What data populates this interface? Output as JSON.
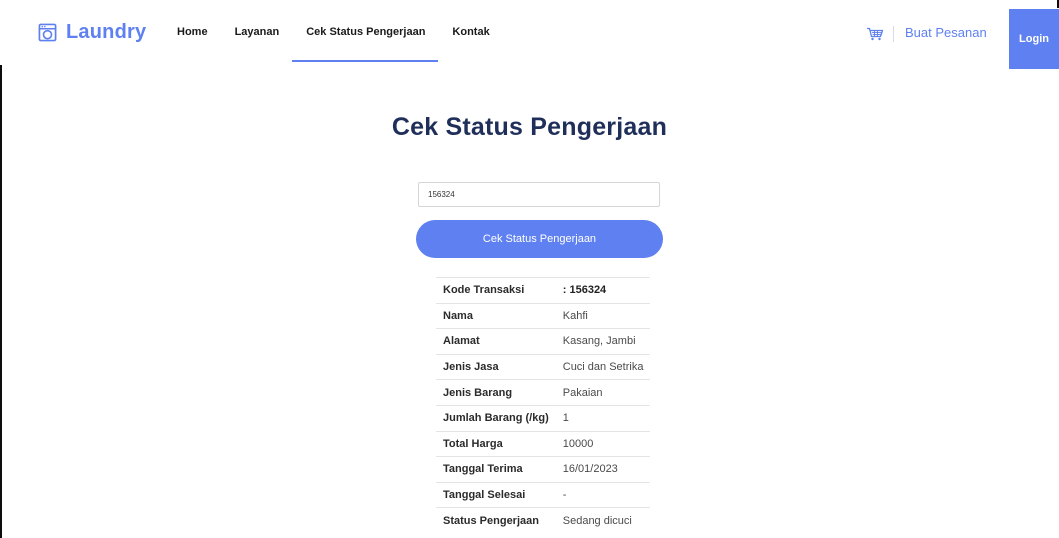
{
  "brand": {
    "name": "Laundry",
    "icon": "washing-machine-icon",
    "color": "#5f80f0"
  },
  "nav": {
    "items": [
      {
        "label": "Home"
      },
      {
        "label": "Layanan"
      },
      {
        "label": "Cek Status Pengerjaan",
        "active": true
      },
      {
        "label": "Kontak"
      }
    ],
    "cart_icon": "cart-icon",
    "order_label": "Buat Pesanan",
    "login_label": "Login"
  },
  "main": {
    "title": "Cek Status Pengerjaan",
    "search": {
      "value": "156324",
      "placeholder": ""
    },
    "submit_label": "Cek Status Pengerjaan",
    "details": [
      {
        "label": "Kode Transaksi",
        "value": ": 156324"
      },
      {
        "label": "Nama",
        "value": "Kahfi"
      },
      {
        "label": "Alamat",
        "value": "Kasang, Jambi"
      },
      {
        "label": "Jenis Jasa",
        "value": "Cuci dan Setrika"
      },
      {
        "label": "Jenis Barang",
        "value": "Pakaian"
      },
      {
        "label": "Jumlah Barang (/kg)",
        "value": "1"
      },
      {
        "label": "Total Harga",
        "value": "10000"
      },
      {
        "label": "Tanggal Terima",
        "value": "16/01/2023"
      },
      {
        "label": "Tanggal Selesai",
        "value": "-"
      },
      {
        "label": "Status Pengerjaan",
        "value": "Sedang dicuci"
      }
    ]
  },
  "colors": {
    "accent": "#5f80f0",
    "title": "#1f2f59"
  }
}
